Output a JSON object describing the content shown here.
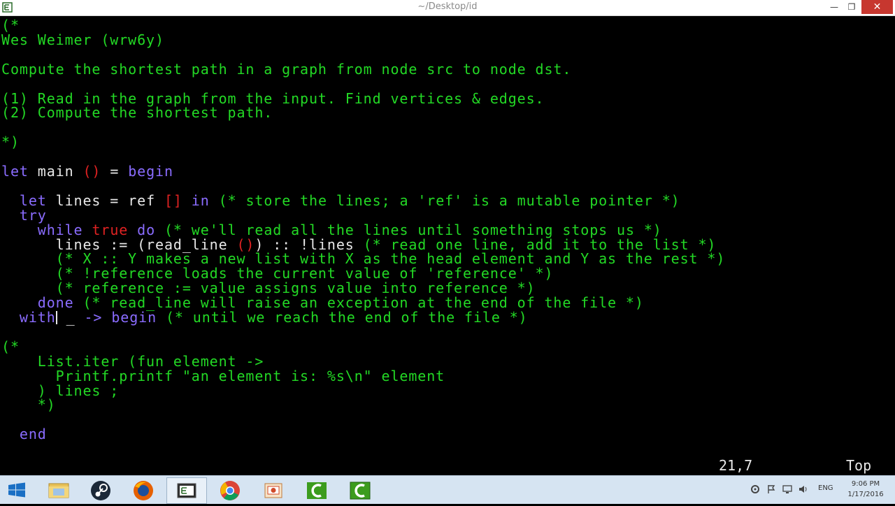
{
  "window": {
    "title": "~/Desktop/id",
    "minimize": "—",
    "maximize": "❐",
    "close": "✕"
  },
  "editor": {
    "lines": [
      [
        {
          "t": "(*",
          "c": "g"
        }
      ],
      [
        {
          "t": "Wes Weimer (wrw6y)",
          "c": "g"
        }
      ],
      [],
      [
        {
          "t": "Compute the shortest path in a graph from node src to node dst.",
          "c": "g"
        }
      ],
      [],
      [
        {
          "t": "(1) Read in the graph from the input. Find vertices & edges.",
          "c": "g"
        }
      ],
      [
        {
          "t": "(2) Compute the shortest path.",
          "c": "g"
        }
      ],
      [],
      [
        {
          "t": "*)",
          "c": "g"
        }
      ],
      [],
      [
        {
          "t": "let",
          "c": "p"
        },
        {
          "t": " main ",
          "c": "w"
        },
        {
          "t": "()",
          "c": "r"
        },
        {
          "t": " = ",
          "c": "w"
        },
        {
          "t": "begin",
          "c": "p"
        }
      ],
      [],
      [
        {
          "t": "  ",
          "c": "w"
        },
        {
          "t": "let",
          "c": "p"
        },
        {
          "t": " lines = ref ",
          "c": "w"
        },
        {
          "t": "[]",
          "c": "r"
        },
        {
          "t": " ",
          "c": "w"
        },
        {
          "t": "in",
          "c": "p"
        },
        {
          "t": " (* store the lines; a 'ref' is a mutable pointer *)",
          "c": "g"
        }
      ],
      [
        {
          "t": "  ",
          "c": "w"
        },
        {
          "t": "try",
          "c": "p"
        }
      ],
      [
        {
          "t": "    ",
          "c": "w"
        },
        {
          "t": "while",
          "c": "p"
        },
        {
          "t": " ",
          "c": "w"
        },
        {
          "t": "true",
          "c": "r"
        },
        {
          "t": " ",
          "c": "w"
        },
        {
          "t": "do",
          "c": "p"
        },
        {
          "t": " (* we'll read all the lines until something stops us *)",
          "c": "g"
        }
      ],
      [
        {
          "t": "      lines := (read_line ",
          "c": "w"
        },
        {
          "t": "()",
          "c": "r"
        },
        {
          "t": ") :: !lines ",
          "c": "w"
        },
        {
          "t": "(* read one line, add it to the list *)",
          "c": "g"
        }
      ],
      [
        {
          "t": "      (* X :: Y makes a new list with X as the head element and Y as the rest *)",
          "c": "g"
        }
      ],
      [
        {
          "t": "      (* !reference loads the current value of 'reference' *)",
          "c": "g"
        }
      ],
      [
        {
          "t": "      (* reference := value assigns value into reference *)",
          "c": "g"
        }
      ],
      [
        {
          "t": "    ",
          "c": "w"
        },
        {
          "t": "done",
          "c": "p"
        },
        {
          "t": " (* read_line will raise an exception at the end of the file *)",
          "c": "g"
        }
      ],
      [
        {
          "t": "  ",
          "c": "w"
        },
        {
          "t": "with",
          "c": "p"
        },
        {
          "t": "CURSOR",
          "c": "cursor"
        },
        {
          "t": " _ ",
          "c": "w"
        },
        {
          "t": "->",
          "c": "p"
        },
        {
          "t": " ",
          "c": "w"
        },
        {
          "t": "begin",
          "c": "p"
        },
        {
          "t": " (* until we reach the end of the file *)",
          "c": "g"
        }
      ],
      [],
      [
        {
          "t": "(*",
          "c": "g"
        }
      ],
      [
        {
          "t": "    List.iter (fun element ->",
          "c": "g"
        }
      ],
      [
        {
          "t": "      Printf.printf \"an element is: %s\\n\" element",
          "c": "g"
        }
      ],
      [
        {
          "t": "    ) lines ;",
          "c": "g"
        }
      ],
      [
        {
          "t": "    *)",
          "c": "g"
        }
      ],
      [],
      [
        {
          "t": "  ",
          "c": "w"
        },
        {
          "t": "end",
          "c": "p"
        }
      ]
    ],
    "position": "21,7",
    "scroll": "Top"
  },
  "taskbar": {
    "apps": [
      {
        "name": "file-explorer",
        "active": false
      },
      {
        "name": "steam",
        "active": false
      },
      {
        "name": "firefox",
        "active": false
      },
      {
        "name": "terminal",
        "active": true
      },
      {
        "name": "chrome",
        "active": false
      },
      {
        "name": "powerpoint",
        "active": false
      },
      {
        "name": "cygwin",
        "active": false
      },
      {
        "name": "cygwin",
        "active": false
      }
    ],
    "lang": "ENG",
    "time": "9:06 PM",
    "date": "1/17/2016"
  },
  "colors": {
    "comment": "#23d925",
    "keyword": "#8a6cff",
    "literal": "#e02222",
    "text": "#e8e8e8",
    "close": "#c7372f"
  }
}
